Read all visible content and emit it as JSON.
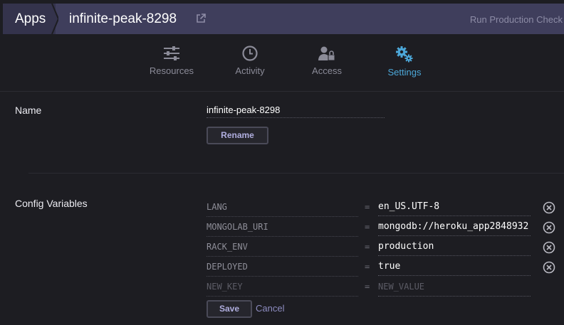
{
  "header": {
    "apps_label": "Apps",
    "app_name": "infinite-peak-8298",
    "run_check_label": "Run Production Check"
  },
  "nav": {
    "tabs": [
      {
        "label": "Resources",
        "icon": "sliders-icon",
        "active": false
      },
      {
        "label": "Activity",
        "icon": "clock-icon",
        "active": false
      },
      {
        "label": "Access",
        "icon": "user-lock-icon",
        "active": false
      },
      {
        "label": "Settings",
        "icon": "gears-icon",
        "active": true
      }
    ]
  },
  "name_section": {
    "label": "Name",
    "value": "infinite-peak-8298",
    "rename_label": "Rename"
  },
  "config_section": {
    "label": "Config Variables",
    "vars": [
      {
        "key": "LANG",
        "eq": "=",
        "value": "en_US.UTF-8"
      },
      {
        "key": "MONGOLAB_URI",
        "eq": "=",
        "value": "mongodb://heroku_app2848932"
      },
      {
        "key": "RACK_ENV",
        "eq": "=",
        "value": "production"
      },
      {
        "key": "DEPLOYED",
        "eq": "=",
        "value": "true"
      }
    ],
    "new_key_placeholder": "NEW_KEY",
    "new_value_placeholder": "NEW_VALUE",
    "new_eq": "=",
    "save_label": "Save",
    "cancel_label": "Cancel"
  },
  "colors": {
    "background": "#1d1d22",
    "topbar": "#3f3e5c",
    "accent": "#4ca7d8",
    "button_text": "#b0aedf"
  }
}
